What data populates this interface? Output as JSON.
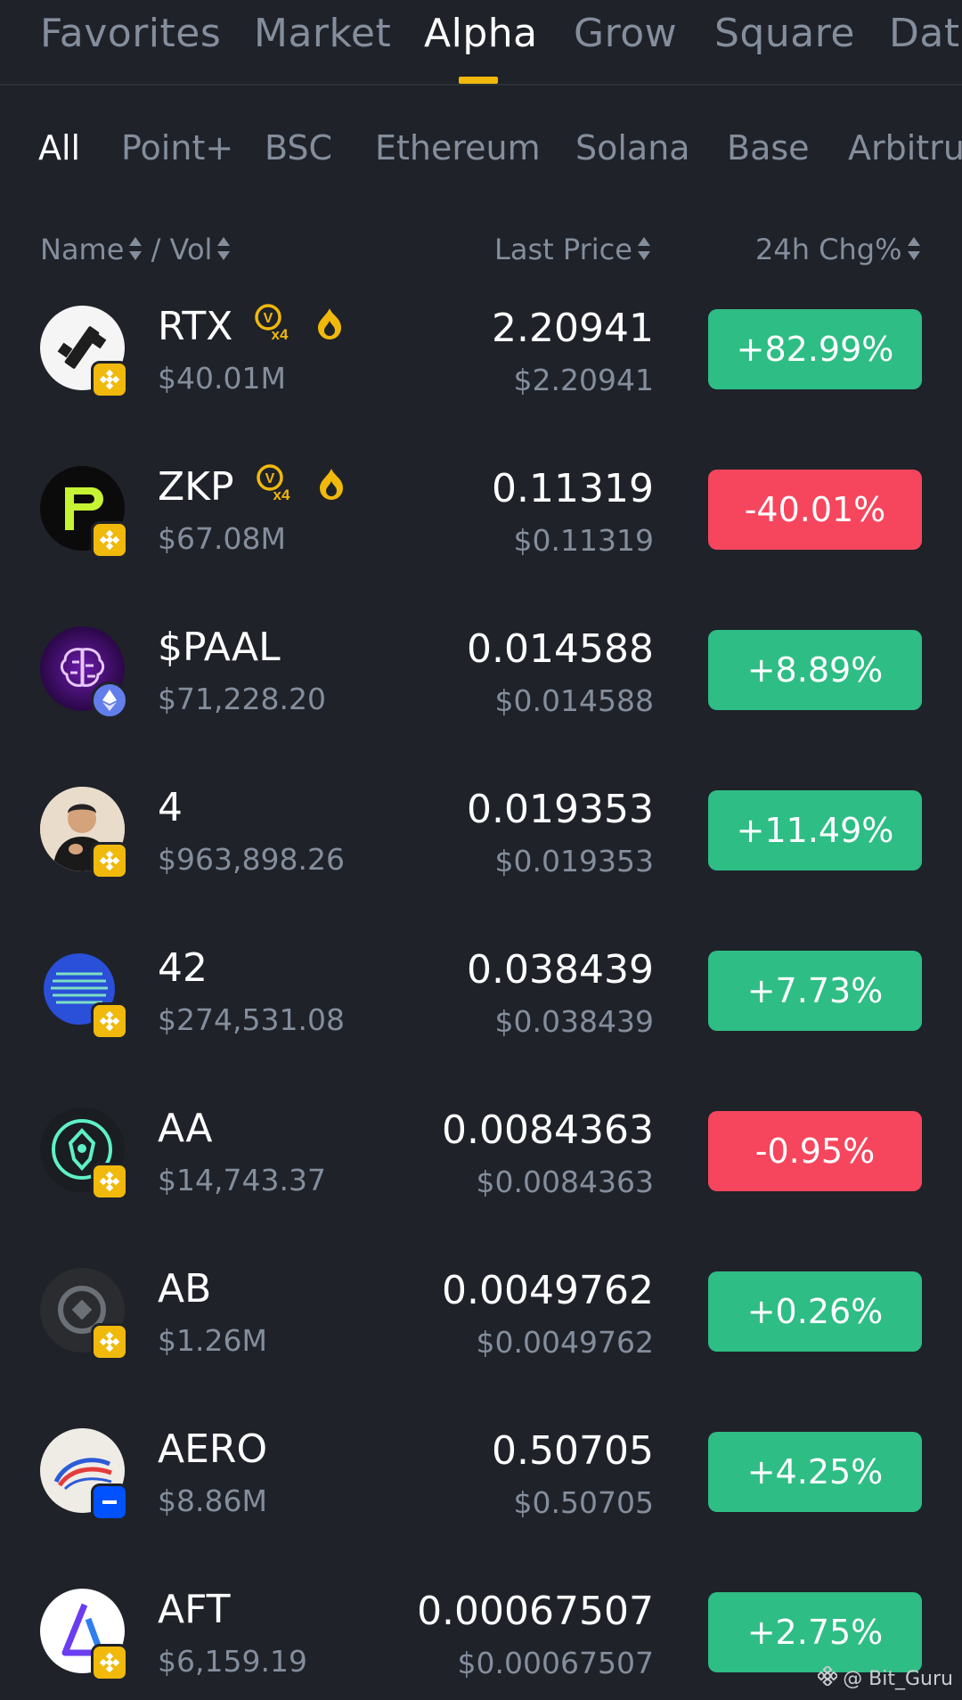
{
  "top_tabs": [
    "Favorites",
    "Market",
    "Alpha",
    "Grow",
    "Square",
    "Data"
  ],
  "active_top_tab": "Alpha",
  "chains": [
    "All",
    "Point+",
    "BSC",
    "Ethereum",
    "Solana",
    "Base",
    "Arbitrum"
  ],
  "active_chain": "All",
  "headers": {
    "name": "Name",
    "separator": "/",
    "vol": "Vol",
    "last_price": "Last Price",
    "change": "24h Chg%"
  },
  "tokens": [
    {
      "symbol": "RTX",
      "volume": "$40.01M",
      "price": "2.20941",
      "price_usd": "$2.20941",
      "change": "+82.99%",
      "direction": "up",
      "chain": "bnb",
      "tags": [
        "v4-badge-icon",
        "flame-icon"
      ]
    },
    {
      "symbol": "ZKP",
      "volume": "$67.08M",
      "price": "0.11319",
      "price_usd": "$0.11319",
      "change": "-40.01%",
      "direction": "down",
      "chain": "bnb",
      "tags": [
        "v4-badge-icon",
        "flame-icon"
      ]
    },
    {
      "symbol": "$PAAL",
      "volume": "$71,228.20",
      "price": "0.014588",
      "price_usd": "$0.014588",
      "change": "+8.89%",
      "direction": "up",
      "chain": "eth",
      "tags": []
    },
    {
      "symbol": "4",
      "volume": "$963,898.26",
      "price": "0.019353",
      "price_usd": "$0.019353",
      "change": "+11.49%",
      "direction": "up",
      "chain": "bnb",
      "tags": []
    },
    {
      "symbol": "42",
      "volume": "$274,531.08",
      "price": "0.038439",
      "price_usd": "$0.038439",
      "change": "+7.73%",
      "direction": "up",
      "chain": "bnb",
      "tags": []
    },
    {
      "symbol": "AA",
      "volume": "$14,743.37",
      "price": "0.0084363",
      "price_usd": "$0.0084363",
      "change": "-0.95%",
      "direction": "down",
      "chain": "bnb",
      "tags": []
    },
    {
      "symbol": "AB",
      "volume": "$1.26M",
      "price": "0.0049762",
      "price_usd": "$0.0049762",
      "change": "+0.26%",
      "direction": "up",
      "chain": "bnb",
      "tags": []
    },
    {
      "symbol": "AERO",
      "volume": "$8.86M",
      "price": "0.50705",
      "price_usd": "$0.50705",
      "change": "+4.25%",
      "direction": "up",
      "chain": "base",
      "tags": []
    },
    {
      "symbol": "AFT",
      "volume": "$6,159.19",
      "price": "0.00067507",
      "price_usd": "$0.00067507",
      "change": "+2.75%",
      "direction": "up",
      "chain": "bnb",
      "tags": []
    }
  ],
  "watermark": "@ Bit_Guru",
  "colors": {
    "up": "#2ebd85",
    "down": "#f6465d",
    "accent": "#f0b90b",
    "background": "#1f2229"
  }
}
